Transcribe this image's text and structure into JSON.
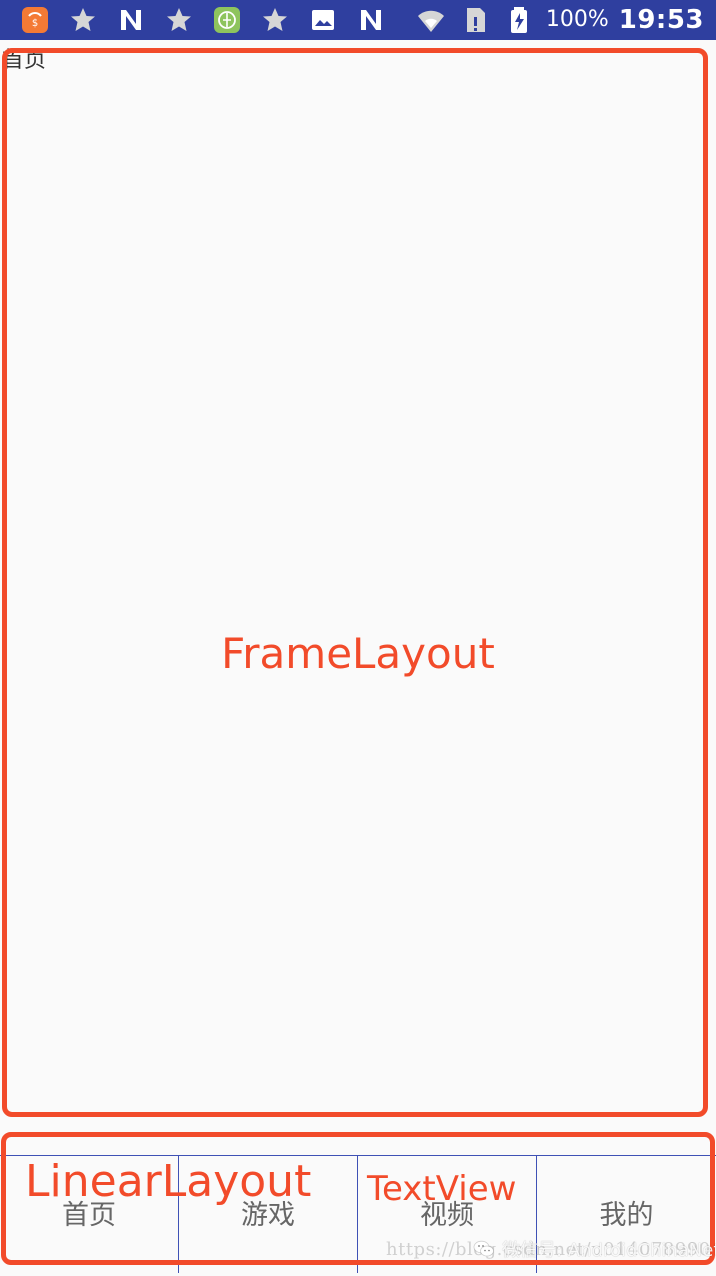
{
  "status_bar": {
    "battery": "100%",
    "time": "19:53",
    "left_icons": [
      "app-icon",
      "star-icon",
      "n-icon",
      "star-icon",
      "green-app-icon",
      "star-icon",
      "image-icon",
      "n-icon"
    ],
    "right_icons": [
      "wifi-icon",
      "sim-alert-icon",
      "battery-icon"
    ],
    "background": "#2f3f9f"
  },
  "screen": {
    "top_label": "首页",
    "frame_layout_label": "FrameLayout",
    "linear_layout_label": "LinearLayout",
    "textview_label": "TextView"
  },
  "bottom_nav": {
    "items": [
      {
        "label": "首页"
      },
      {
        "label": "游戏"
      },
      {
        "label": "视频"
      },
      {
        "label": "我的"
      }
    ]
  },
  "watermark": {
    "url": "https://blog.csdn.net/u014078990",
    "label": "微信号: AndroidChinaNet",
    "icon": "wechat-icon"
  },
  "colors": {
    "annotation": "#f24b2a",
    "status_bar": "#2f3f9f",
    "divider": "#3f51b5",
    "nav_text": "#666666"
  }
}
